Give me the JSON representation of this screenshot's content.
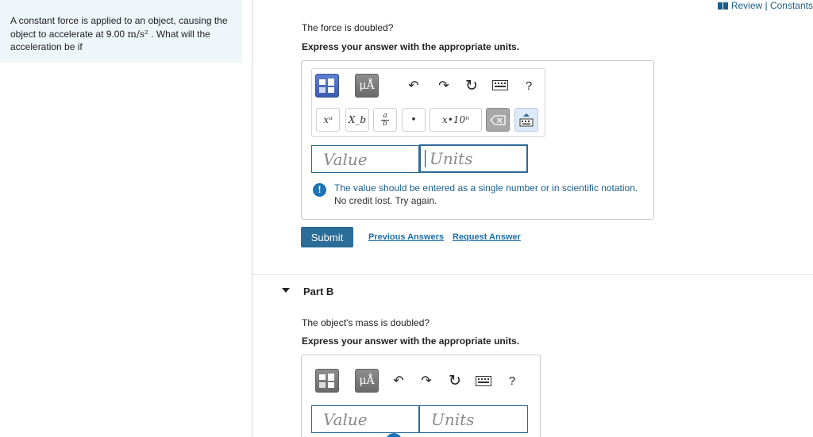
{
  "header": {
    "links_label": "Review | Constants"
  },
  "problem": {
    "text_a": "A constant force is applied to an object, causing the object to accelerate at 9.00 ",
    "unit": "m/s²",
    "text_b": " . What will the acceleration be if"
  },
  "part_a": {
    "question": "The force is doubled?",
    "instruction": "Express your answer with the appropriate units.",
    "toolbar": {
      "mu_label": "μÅ",
      "undo": "↶",
      "redo": "↷",
      "reset": "↻",
      "help": "?",
      "superscript": "xᵃ",
      "subscript": "X_b",
      "frac_num": "a",
      "frac_den": "b",
      "dot": "•",
      "sci": "x•10ⁿ",
      "delete": "⌫"
    },
    "value_placeholder": "Value",
    "units_placeholder": "Units",
    "warning_line1": "The value should be entered as a single number or in scientific notation.",
    "warning_line2": "No credit lost. Try again.",
    "submit_label": "Submit",
    "previous_answers": "Previous Answers",
    "request_answer": "Request Answer"
  },
  "part_b": {
    "title": "Part B",
    "question": "The object's mass is doubled?",
    "instruction": "Express your answer with the appropriate units.",
    "toolbar": {
      "mu_label": "μÅ",
      "undo": "↶",
      "redo": "↷",
      "reset": "↻",
      "help": "?"
    },
    "value_placeholder": "Value",
    "units_placeholder": "Units"
  },
  "colors": {
    "accent": "#2a6d98",
    "panel_bg": "#eef6fa",
    "link": "#1b6ea8",
    "template_blue": "#3b5bb0"
  }
}
